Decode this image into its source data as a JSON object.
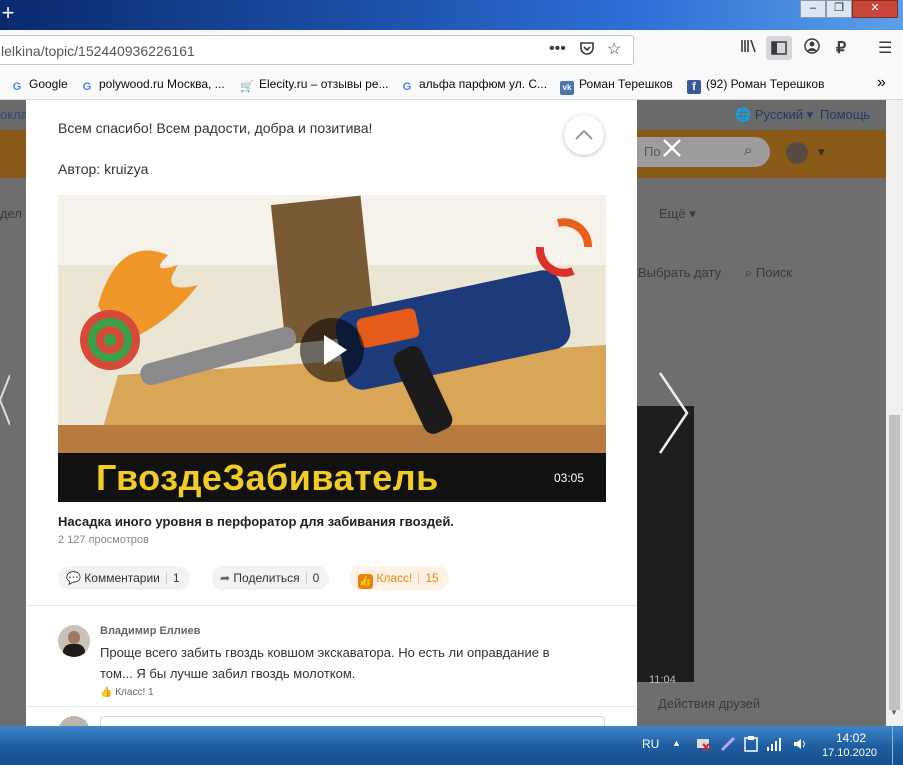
{
  "browser": {
    "url": "lelkina/topic/152440936226161",
    "bookmarks": [
      {
        "label": "Google",
        "icon": "google-icon",
        "color": "#4285f4"
      },
      {
        "label": "polywood.ru Москва, ...",
        "icon": "google-icon",
        "color": "#4285f4"
      },
      {
        "label": "Elecity.ru – отзывы ре...",
        "icon": "cart-icon",
        "color": "#f0a030"
      },
      {
        "label": "альфа парфюм ул. С...",
        "icon": "google-icon",
        "color": "#4285f4"
      },
      {
        "label": "Роман Терешков",
        "icon": "vk-icon",
        "color": "#4a76a8"
      },
      {
        "label": "(92) Роман Терешков",
        "icon": "facebook-icon",
        "color": "#3b5998"
      }
    ]
  },
  "site_bg": {
    "lang": "Русский",
    "help": "Помощь",
    "search_placeholder": "По",
    "more_menu": "Ещё",
    "left_cut": "дел",
    "left_cut2": "окла",
    "choose_date": "Выбрать дату",
    "search_label": "Поиск",
    "friends_actions": "Действия друзей",
    "video_time": "11:04"
  },
  "post": {
    "thanks_text": "Всем спасибо! Всем радости, добра и позитива!",
    "author_text": "Автор: kruizya",
    "video_banner": "ГвоздеЗабиватель",
    "video_duration": "03:05",
    "video_title": "Насадка иного уровня в перфоратор для забивания гвоздей.",
    "views": "2 127 просмотров",
    "comments_label": "Комментарии",
    "comments_count": "1",
    "share_label": "Поделиться",
    "share_count": "0",
    "like_label": "Класс!",
    "like_count": "15"
  },
  "comment": {
    "author": "Владимир Еллиев",
    "text_line1": "Проще всего забить гвоздь ковшом экскаватора. Но есть ли оправдание  в",
    "text_line2": "том... Я бы лучше забил гвоздь молотком.",
    "like_label": "Класс! 1"
  },
  "taskbar": {
    "lang": "RU",
    "time": "14:02",
    "date": "17.10.2020"
  },
  "colors": {
    "accent_orange": "#ee8208",
    "like_bg": "#fdf2e3"
  }
}
